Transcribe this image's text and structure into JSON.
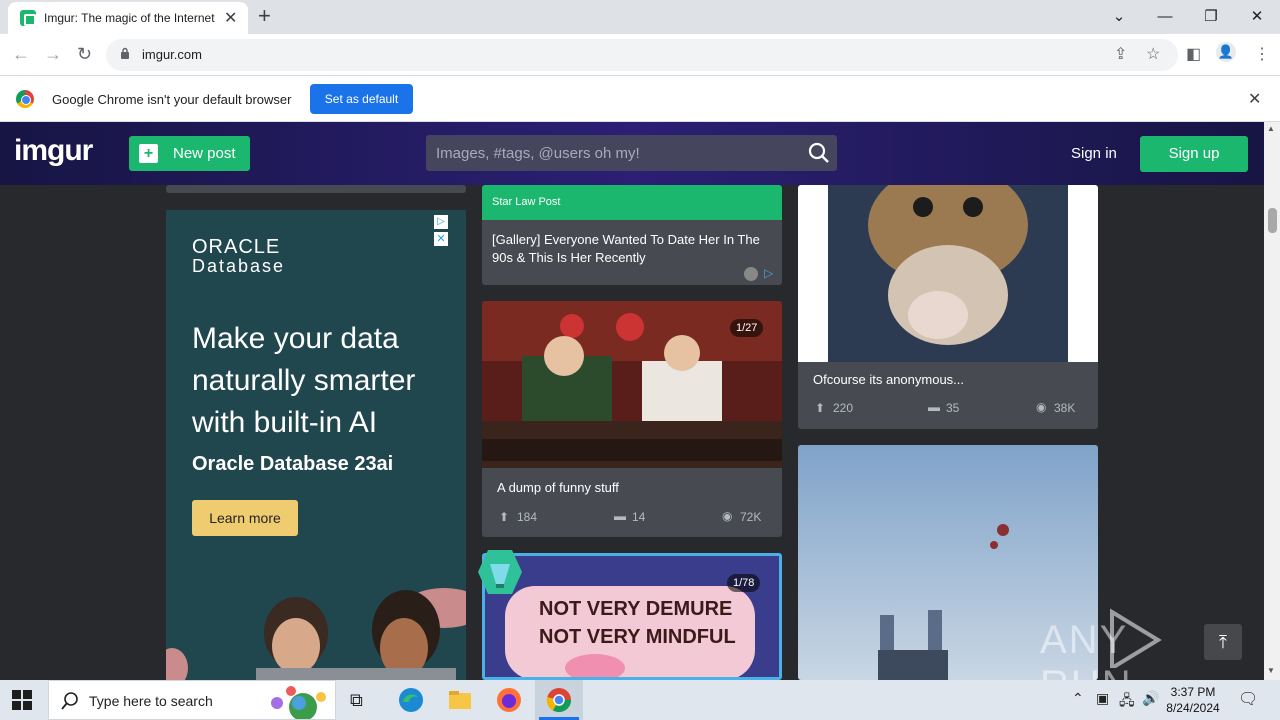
{
  "browser": {
    "tab_title": "Imgur: The magic of the Internet",
    "url": "imgur.com",
    "infobar_message": "Google Chrome isn't your default browser",
    "infobar_button": "Set as default"
  },
  "header": {
    "logo": "imgur",
    "new_post": "New post",
    "search_placeholder": "Images, #tags, @users oh my!",
    "sign_in": "Sign in",
    "sign_up": "Sign up"
  },
  "ad": {
    "brand_line1": "ORACLE",
    "brand_line2": "Database",
    "headline": "Make your data naturally smarter with built-in AI",
    "product": "Oracle Database 23ai",
    "cta": "Learn more"
  },
  "col2": {
    "promo_source": "Star Law Post",
    "promo_title": "[Gallery] Everyone Wanted To Date Her In The 90s & This Is Her Recently",
    "post1": {
      "badge": "1/27",
      "title": "A dump of funny stuff",
      "upvotes": "184",
      "comments": "14",
      "views": "72K"
    },
    "post2": {
      "badge": "1/78",
      "image_text_line1": "NOT VERY DEMURE",
      "image_text_line2": "NOT VERY MINDFUL"
    }
  },
  "col3": {
    "post1": {
      "title": "Ofcourse its anonymous...",
      "upvotes": "220",
      "comments": "35",
      "views": "38K"
    }
  },
  "taskbar": {
    "search_placeholder": "Type here to search",
    "time": "3:37 PM",
    "date": "8/24/2024"
  },
  "watermark": "ANY RUN",
  "colors": {
    "imgur_green": "#1bb76e",
    "page_bg": "#27292d",
    "card_bg": "#474a51",
    "chrome_blue": "#1a73e8"
  }
}
